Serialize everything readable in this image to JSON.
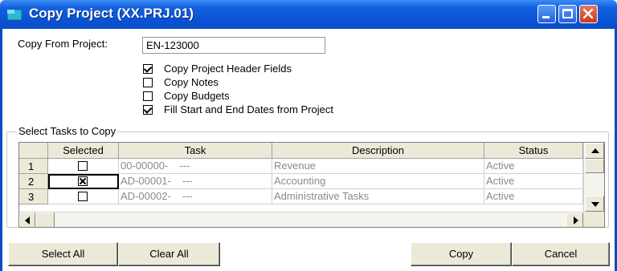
{
  "window": {
    "title": "Copy Project (XX.PRJ.01)",
    "accent_color": "#0a4cc4"
  },
  "form": {
    "copy_from_label": "Copy From Project:",
    "copy_from_value": "EN-123000",
    "options": [
      {
        "label": "Copy Project Header Fields",
        "checked": true
      },
      {
        "label": "Copy Notes",
        "checked": false
      },
      {
        "label": "Copy Budgets",
        "checked": false
      },
      {
        "label": "Fill Start and End Dates from Project",
        "checked": true
      }
    ]
  },
  "tasks": {
    "group_title": "Select Tasks to Copy",
    "columns": [
      "Selected",
      "Task",
      "Description",
      "Status"
    ],
    "rows": [
      {
        "num": "1",
        "selected": false,
        "task": "00-00000-",
        "task_suffix": "---",
        "description": "Revenue",
        "status": "Active"
      },
      {
        "num": "2",
        "selected": true,
        "task": "AD-00001-",
        "task_suffix": "---",
        "description": "Accounting",
        "status": "Active"
      },
      {
        "num": "3",
        "selected": false,
        "task": "AD-00002-",
        "task_suffix": "---",
        "description": "Administrative Tasks",
        "status": "Active"
      }
    ]
  },
  "buttons": {
    "select_all": "Select All",
    "clear_all": "Clear All",
    "copy": "Copy",
    "cancel": "Cancel"
  }
}
